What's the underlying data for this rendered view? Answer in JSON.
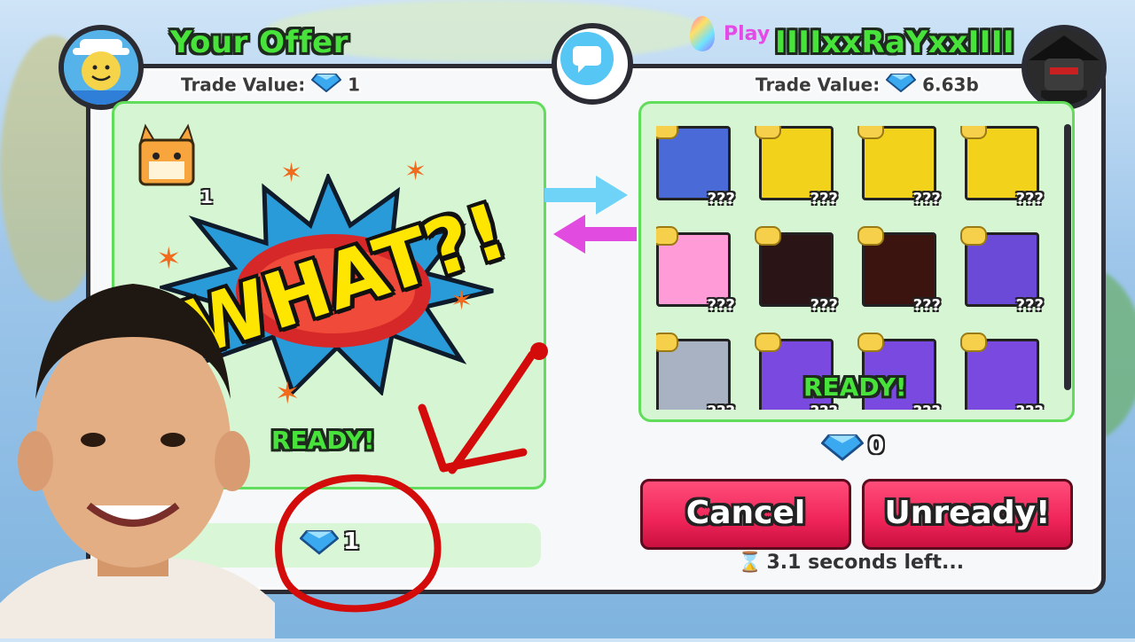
{
  "your_offer": {
    "title": "Your Offer",
    "trade_value_label": "Trade Value:",
    "trade_value": "1",
    "pet_count": "1",
    "ready": "READY!",
    "diamond_amount": "1"
  },
  "partner": {
    "name": "IIIIxxRaYxxIIII",
    "trade_value_label": "Trade Value:",
    "trade_value": "6.63b",
    "ready": "READY!",
    "diamond_amount": "0",
    "slots": [
      {
        "label": "???",
        "color": "#4a6ad8"
      },
      {
        "label": "???",
        "color": "#f3d21b"
      },
      {
        "label": "???",
        "color": "#f3d21b"
      },
      {
        "label": "???",
        "color": "#f3d21b"
      },
      {
        "label": "???",
        "color": "#ff9bd6"
      },
      {
        "label": "???",
        "color": "#2a1416"
      },
      {
        "label": "???",
        "color": "#3b1410"
      },
      {
        "label": "???",
        "color": "#6a4ad6"
      },
      {
        "label": "???",
        "color": "#a8b2c2"
      },
      {
        "label": "???",
        "color": "#7a4ae0"
      },
      {
        "label": "???",
        "color": "#7a4ae0"
      },
      {
        "label": "???",
        "color": "#7a4ae0"
      }
    ]
  },
  "overlay": {
    "what_text": "WHAT?!",
    "banner_text": "Play"
  },
  "actions": {
    "cancel": "Cancel",
    "unready": "Unready!",
    "timer": "3.1 seconds left..."
  },
  "colors": {
    "green": "#47e33a",
    "pink_button": "#ef2458",
    "panel_green": "#d5f5d3",
    "diamond": "#3aa9f0"
  }
}
